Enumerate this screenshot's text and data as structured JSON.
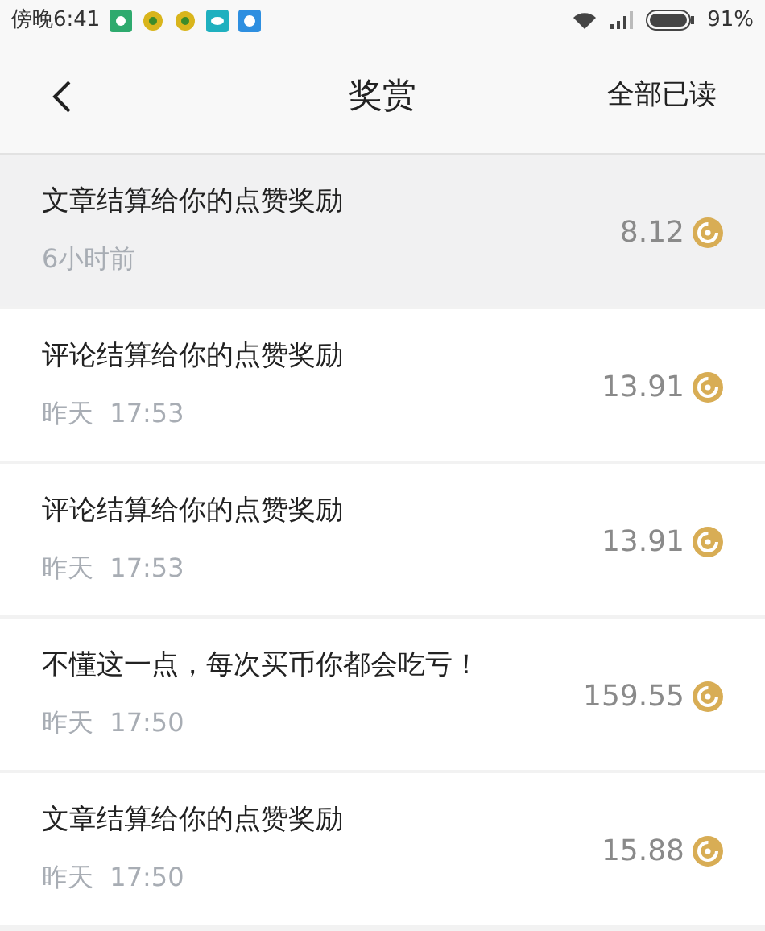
{
  "status_bar": {
    "time": "傍晚6:41",
    "battery": "91%"
  },
  "header": {
    "title": "奖赏",
    "action": "全部已读"
  },
  "items": [
    {
      "title": "文章结算给你的点赞奖励",
      "time": "6小时前",
      "amount": "8.12",
      "highlighted": true
    },
    {
      "title": "评论结算给你的点赞奖励",
      "time": "昨天  17:53",
      "amount": "13.91",
      "highlighted": false
    },
    {
      "title": "评论结算给你的点赞奖励",
      "time": "昨天  17:53",
      "amount": "13.91",
      "highlighted": false
    },
    {
      "title": "不懂这一点，每次买币你都会吃亏！",
      "time": "昨天  17:50",
      "amount": "159.55",
      "highlighted": false
    },
    {
      "title": "文章结算给你的点赞奖励",
      "time": "昨天  17:50",
      "amount": "15.88",
      "highlighted": false
    }
  ]
}
